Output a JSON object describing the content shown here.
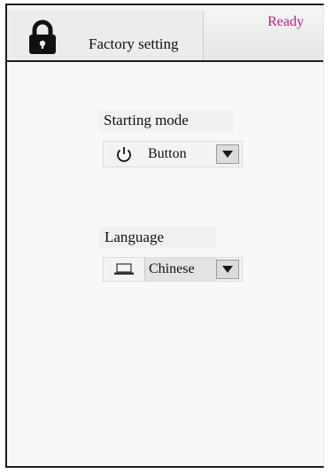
{
  "header": {
    "title": "Factory setting",
    "status": "Ready",
    "lock_icon": "lock-icon"
  },
  "starting_mode": {
    "label": "Starting mode",
    "value": "Button",
    "icon": "power-icon"
  },
  "language": {
    "label": "Language",
    "value": "Chinese",
    "icon": "laptop-icon"
  },
  "colors": {
    "status": "#c1198c",
    "header_border": "#1e1e1e"
  }
}
